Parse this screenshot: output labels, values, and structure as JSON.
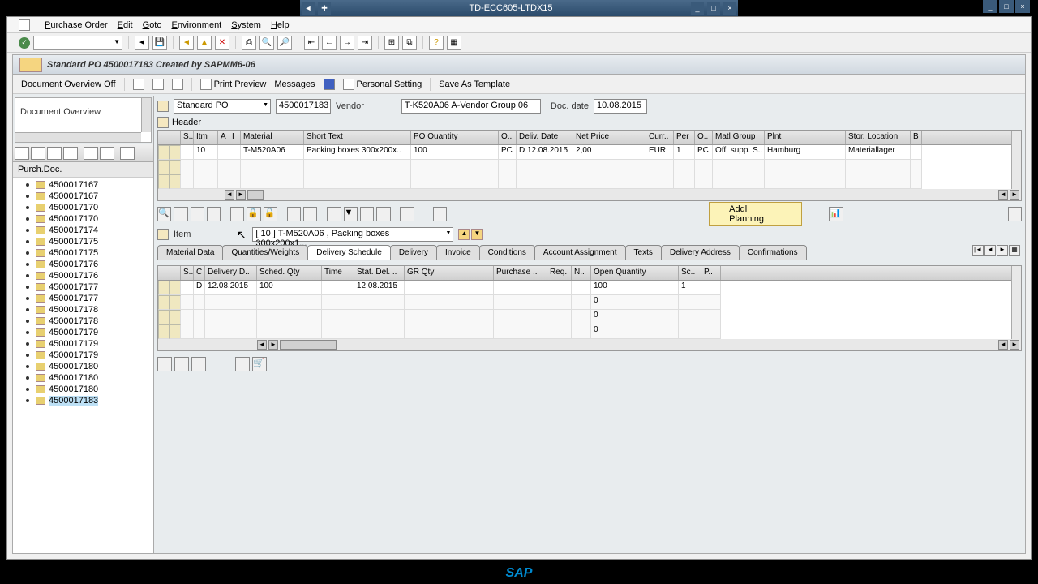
{
  "window": {
    "title": "TD-ECC605-LTDX15"
  },
  "menu": {
    "items": [
      "Purchase Order",
      "Edit",
      "Goto",
      "Environment",
      "System",
      "Help"
    ]
  },
  "panel_title": "Standard PO 4500017183 Created by SAPMM6-06",
  "action_bar": {
    "doc_overview": "Document Overview Off",
    "print_preview": "Print Preview",
    "messages": "Messages",
    "personal": "Personal Setting",
    "save_template": "Save As Template"
  },
  "doc_overview": {
    "title": "Document Overview",
    "purch_doc": "Purch.Doc.",
    "items": [
      "4500017167",
      "4500017167",
      "4500017170",
      "4500017170",
      "4500017174",
      "4500017175",
      "4500017175",
      "4500017176",
      "4500017176",
      "4500017177",
      "4500017177",
      "4500017178",
      "4500017178",
      "4500017179",
      "4500017179",
      "4500017179",
      "4500017180",
      "4500017180",
      "4500017180",
      "4500017183"
    ],
    "selected": "4500017183"
  },
  "po_header": {
    "type": "Standard PO",
    "number": "4500017183",
    "vendor_label": "Vendor",
    "vendor": "T-K520A06 A-Vendor Group 06",
    "doc_date_label": "Doc. date",
    "doc_date": "10.08.2015",
    "header_label": "Header"
  },
  "item_grid": {
    "cols": [
      "S..",
      "Itm",
      "A",
      "I",
      "Material",
      "Short Text",
      "PO Quantity",
      "O..",
      "Deliv. Date",
      "Net Price",
      "Curr..",
      "Per",
      "O..",
      "Matl Group",
      "Plnt",
      "Stor. Location",
      "B"
    ],
    "row": {
      "itm": "10",
      "material": "T-M520A06",
      "short_text": "Packing boxes 300x200x..",
      "qty": "100",
      "oun": "PC",
      "deliv": "D 12.08.2015",
      "price": "2,00",
      "curr": "EUR",
      "per": "1",
      "opu": "PC",
      "matl_group": "Off. supp. S..",
      "plnt": "Hamburg",
      "stor": "Materiallager"
    }
  },
  "addl_planning": "Addl Planning",
  "item_detail": {
    "label": "Item",
    "value": "[ 10 ] T-M520A06 , Packing boxes 300x200x1...",
    "tabs": [
      "Material Data",
      "Quantities/Weights",
      "Delivery Schedule",
      "Delivery",
      "Invoice",
      "Conditions",
      "Account Assignment",
      "Texts",
      "Delivery Address",
      "Confirmations"
    ],
    "active_tab": "Delivery Schedule"
  },
  "sched_grid": {
    "cols": [
      "S..",
      "C",
      "Delivery D..",
      "Sched. Qty",
      "Time",
      "Stat. Del. ..",
      "GR Qty",
      "Purchase ..",
      "Req..",
      "N..",
      "Open Quantity",
      "Sc..",
      "P.."
    ],
    "row": {
      "c": "D",
      "date": "12.08.2015",
      "qty": "100",
      "stat": "12.08.2015",
      "open": "100",
      "sc": "1"
    },
    "zeros": [
      "0",
      "0",
      "0"
    ]
  },
  "logo": "SAP"
}
